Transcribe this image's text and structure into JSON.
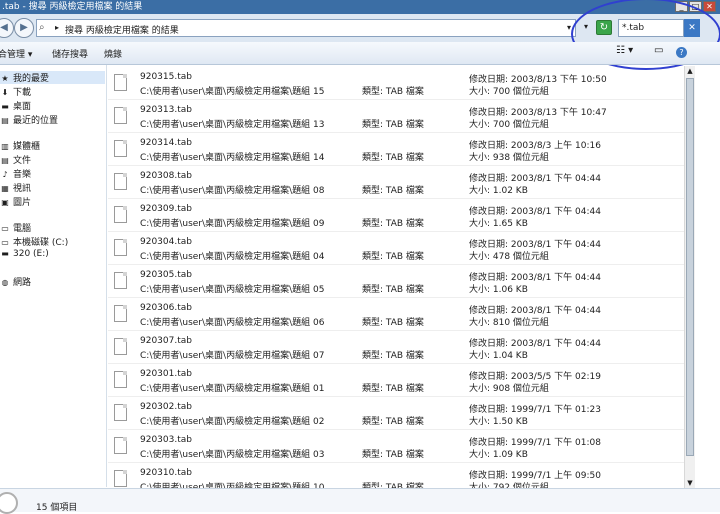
{
  "window": {
    "title": ".tab - 搜尋 丙級檢定用檔案 的結果",
    "minimize": "_",
    "maximize": "□",
    "close": "✕"
  },
  "address": {
    "back": "◀",
    "forward": "▶",
    "crumb": "搜尋 丙級檢定用檔案 的結果",
    "crumb_arrow": "▸",
    "dropdown": "▾",
    "refresh": "↻",
    "search_value": "*.tab",
    "clear": "✕"
  },
  "toolbar": {
    "organize": "合管理 ▾",
    "save_search": "儲存搜尋",
    "burn": "燒錄",
    "views": "☷ ▾",
    "preview": "▭",
    "help": "?"
  },
  "sidebar": {
    "items": [
      {
        "label": "我的最愛",
        "icon": "★"
      },
      {
        "label": "下載",
        "icon": "⬇"
      },
      {
        "label": "桌面",
        "icon": "▬"
      },
      {
        "label": "最近的位置",
        "icon": "▤"
      },
      {
        "label": "媒體櫃",
        "icon": "▥"
      },
      {
        "label": "文件",
        "icon": "▤"
      },
      {
        "label": "音樂",
        "icon": "♪"
      },
      {
        "label": "視訊",
        "icon": "▦"
      },
      {
        "label": "圖片",
        "icon": "▣"
      },
      {
        "label": "電腦",
        "icon": "▭"
      },
      {
        "label": "本機磁碟 (C:)",
        "icon": "▭"
      },
      {
        "label": "320 (E:)",
        "icon": "▬"
      },
      {
        "label": "網路",
        "icon": "◍"
      }
    ]
  },
  "files": [
    {
      "name": "920315.tab",
      "path": "C:\\使用者\\user\\桌面\\丙級檢定用檔案\\題組 15",
      "type": "類型: TAB 檔案",
      "date": "修改日期: 2003/8/13 下午 10:50",
      "size": "大小: 700 個位元組"
    },
    {
      "name": "920313.tab",
      "path": "C:\\使用者\\user\\桌面\\丙級檢定用檔案\\題組 13",
      "type": "類型: TAB 檔案",
      "date": "修改日期: 2003/8/13 下午 10:47",
      "size": "大小: 700 個位元組"
    },
    {
      "name": "920314.tab",
      "path": "C:\\使用者\\user\\桌面\\丙級檢定用檔案\\題組 14",
      "type": "類型: TAB 檔案",
      "date": "修改日期: 2003/8/3 上午 10:16",
      "size": "大小: 938 個位元組"
    },
    {
      "name": "920308.tab",
      "path": "C:\\使用者\\user\\桌面\\丙級檢定用檔案\\題組 08",
      "type": "類型: TAB 檔案",
      "date": "修改日期: 2003/8/1 下午 04:44",
      "size": "大小: 1.02 KB"
    },
    {
      "name": "920309.tab",
      "path": "C:\\使用者\\user\\桌面\\丙級檢定用檔案\\題組 09",
      "type": "類型: TAB 檔案",
      "date": "修改日期: 2003/8/1 下午 04:44",
      "size": "大小: 1.65 KB"
    },
    {
      "name": "920304.tab",
      "path": "C:\\使用者\\user\\桌面\\丙級檢定用檔案\\題組 04",
      "type": "類型: TAB 檔案",
      "date": "修改日期: 2003/8/1 下午 04:44",
      "size": "大小: 478 個位元組"
    },
    {
      "name": "920305.tab",
      "path": "C:\\使用者\\user\\桌面\\丙級檢定用檔案\\題組 05",
      "type": "類型: TAB 檔案",
      "date": "修改日期: 2003/8/1 下午 04:44",
      "size": "大小: 1.06 KB"
    },
    {
      "name": "920306.tab",
      "path": "C:\\使用者\\user\\桌面\\丙級檢定用檔案\\題組 06",
      "type": "類型: TAB 檔案",
      "date": "修改日期: 2003/8/1 下午 04:44",
      "size": "大小: 810 個位元組"
    },
    {
      "name": "920307.tab",
      "path": "C:\\使用者\\user\\桌面\\丙級檢定用檔案\\題組 07",
      "type": "類型: TAB 檔案",
      "date": "修改日期: 2003/8/1 下午 04:44",
      "size": "大小: 1.04 KB"
    },
    {
      "name": "920301.tab",
      "path": "C:\\使用者\\user\\桌面\\丙級檢定用檔案\\題組 01",
      "type": "類型: TAB 檔案",
      "date": "修改日期: 2003/5/5 下午 02:19",
      "size": "大小: 908 個位元組"
    },
    {
      "name": "920302.tab",
      "path": "C:\\使用者\\user\\桌面\\丙級檢定用檔案\\題組 02",
      "type": "類型: TAB 檔案",
      "date": "修改日期: 1999/7/1 下午 01:23",
      "size": "大小: 1.50 KB"
    },
    {
      "name": "920303.tab",
      "path": "C:\\使用者\\user\\桌面\\丙級檢定用檔案\\題組 03",
      "type": "類型: TAB 檔案",
      "date": "修改日期: 1999/7/1 下午 01:08",
      "size": "大小: 1.09 KB"
    },
    {
      "name": "920310.tab",
      "path": "C:\\使用者\\user\\桌面\\丙級檢定用檔案\\題組 10",
      "type": "類型: TAB 檔案",
      "date": "修改日期: 1999/7/1 上午 09:50",
      "size": "大小: 792 個位元組"
    }
  ],
  "scroll": {
    "up": "▲",
    "down": "▼"
  },
  "status": {
    "count": "15 個項目"
  }
}
